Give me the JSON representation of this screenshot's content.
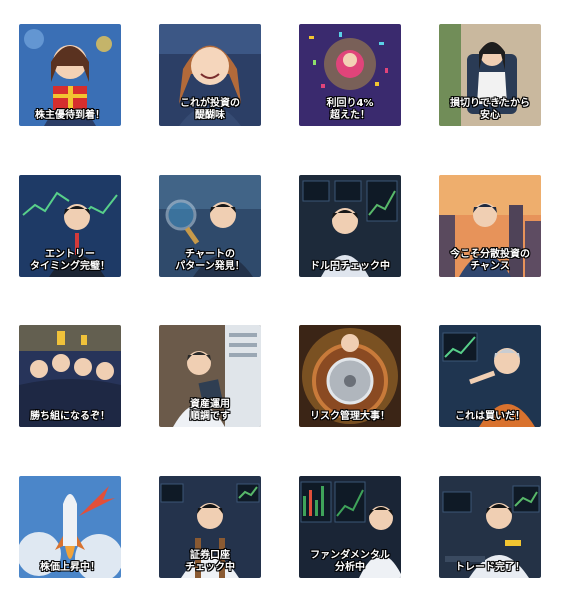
{
  "stickers": [
    {
      "caption": "株主優待到着！",
      "theme": "gift",
      "bg": "#3a6fb5",
      "accent": "#d62e2e"
    },
    {
      "caption": "これが投資の\n醍醐味",
      "theme": "smile",
      "bg": "#2c3f66",
      "accent": "#e89a5c"
    },
    {
      "caption": "利回り4%\n超えた！",
      "theme": "confetti",
      "bg": "#3a2a6e",
      "accent": "#f2c531"
    },
    {
      "caption": "損切りできたから\n安心",
      "theme": "office-chair",
      "bg": "#c9b89e",
      "accent": "#2a3b55"
    },
    {
      "caption": "エントリー\nタイミング完璧！",
      "theme": "charts-suit",
      "bg": "#1e3a66",
      "accent": "#d33a3a"
    },
    {
      "caption": "チャートの\nパターン発見！",
      "theme": "magnifier",
      "bg": "#2f4a6b",
      "accent": "#4aa3d8"
    },
    {
      "caption": "ドル円チェック中",
      "theme": "monitors",
      "bg": "#1d2a3a",
      "accent": "#58b86a"
    },
    {
      "caption": "今こそ分散投資の\nチャンス",
      "theme": "city-sunset",
      "bg": "#e7935a",
      "accent": "#30466e"
    },
    {
      "caption": "勝ち組になるぞ！",
      "theme": "crowd",
      "bg": "#27345a",
      "accent": "#f0c23a"
    },
    {
      "caption": "資産運用\n順調です",
      "theme": "clipboard",
      "bg": "#6b5a4a",
      "accent": "#e0e5ea"
    },
    {
      "caption": "リスク管理大事！",
      "theme": "shield",
      "bg": "#3b2516",
      "accent": "#c87a3a"
    },
    {
      "caption": "これは買いだ！",
      "theme": "pointing",
      "bg": "#1f3550",
      "accent": "#d9722e"
    },
    {
      "caption": "株価上昇中！",
      "theme": "rocket",
      "bg": "#4b86c9",
      "accent": "#f2a33a"
    },
    {
      "caption": "証券口座\nチェック中",
      "theme": "trader",
      "bg": "#24334c",
      "accent": "#58b86a"
    },
    {
      "caption": "ファンダメンタル\n分析中",
      "theme": "screens",
      "bg": "#1a2536",
      "accent": "#3fa35a"
    },
    {
      "caption": "トレード完了！",
      "theme": "desk",
      "bg": "#243246",
      "accent": "#e8ecf2"
    }
  ]
}
